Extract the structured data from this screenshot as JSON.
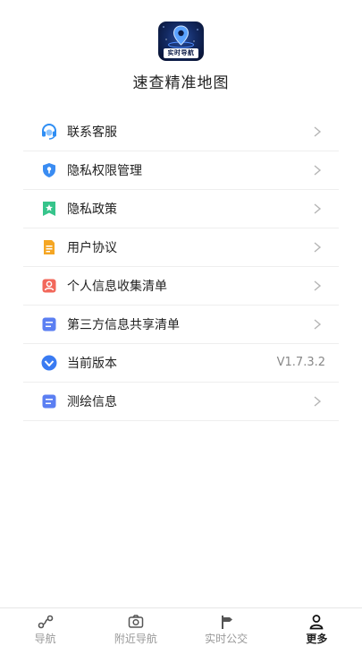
{
  "app": {
    "icon_badge": "实时导航",
    "name": "速查精准地图"
  },
  "menu": [
    {
      "label": "联系客服",
      "icon": "headset-icon",
      "color": "#2f8ef4"
    },
    {
      "label": "隐私权限管理",
      "icon": "shield-icon",
      "color": "#3a8cf2"
    },
    {
      "label": "隐私政策",
      "icon": "bookmark-star-icon",
      "color": "#36c48b"
    },
    {
      "label": "用户协议",
      "icon": "document-icon",
      "color": "#f5a623"
    },
    {
      "label": "个人信息收集清单",
      "icon": "person-card-icon",
      "color": "#f2685b"
    },
    {
      "label": "第三方信息共享清单",
      "icon": "list-icon",
      "color": "#5b7ff2"
    },
    {
      "label": "当前版本",
      "icon": "version-check-icon",
      "color": "#3a7bf2",
      "value": "V1.7.3.2"
    },
    {
      "label": "测绘信息",
      "icon": "list-icon",
      "color": "#5b7ff2"
    }
  ],
  "tabbar": {
    "tabs": [
      {
        "label": "导航",
        "icon": "route-icon"
      },
      {
        "label": "附近导航",
        "icon": "camera-pin-icon"
      },
      {
        "label": "实时公交",
        "icon": "signpost-icon"
      },
      {
        "label": "更多",
        "icon": "user-icon",
        "active": true
      }
    ]
  }
}
